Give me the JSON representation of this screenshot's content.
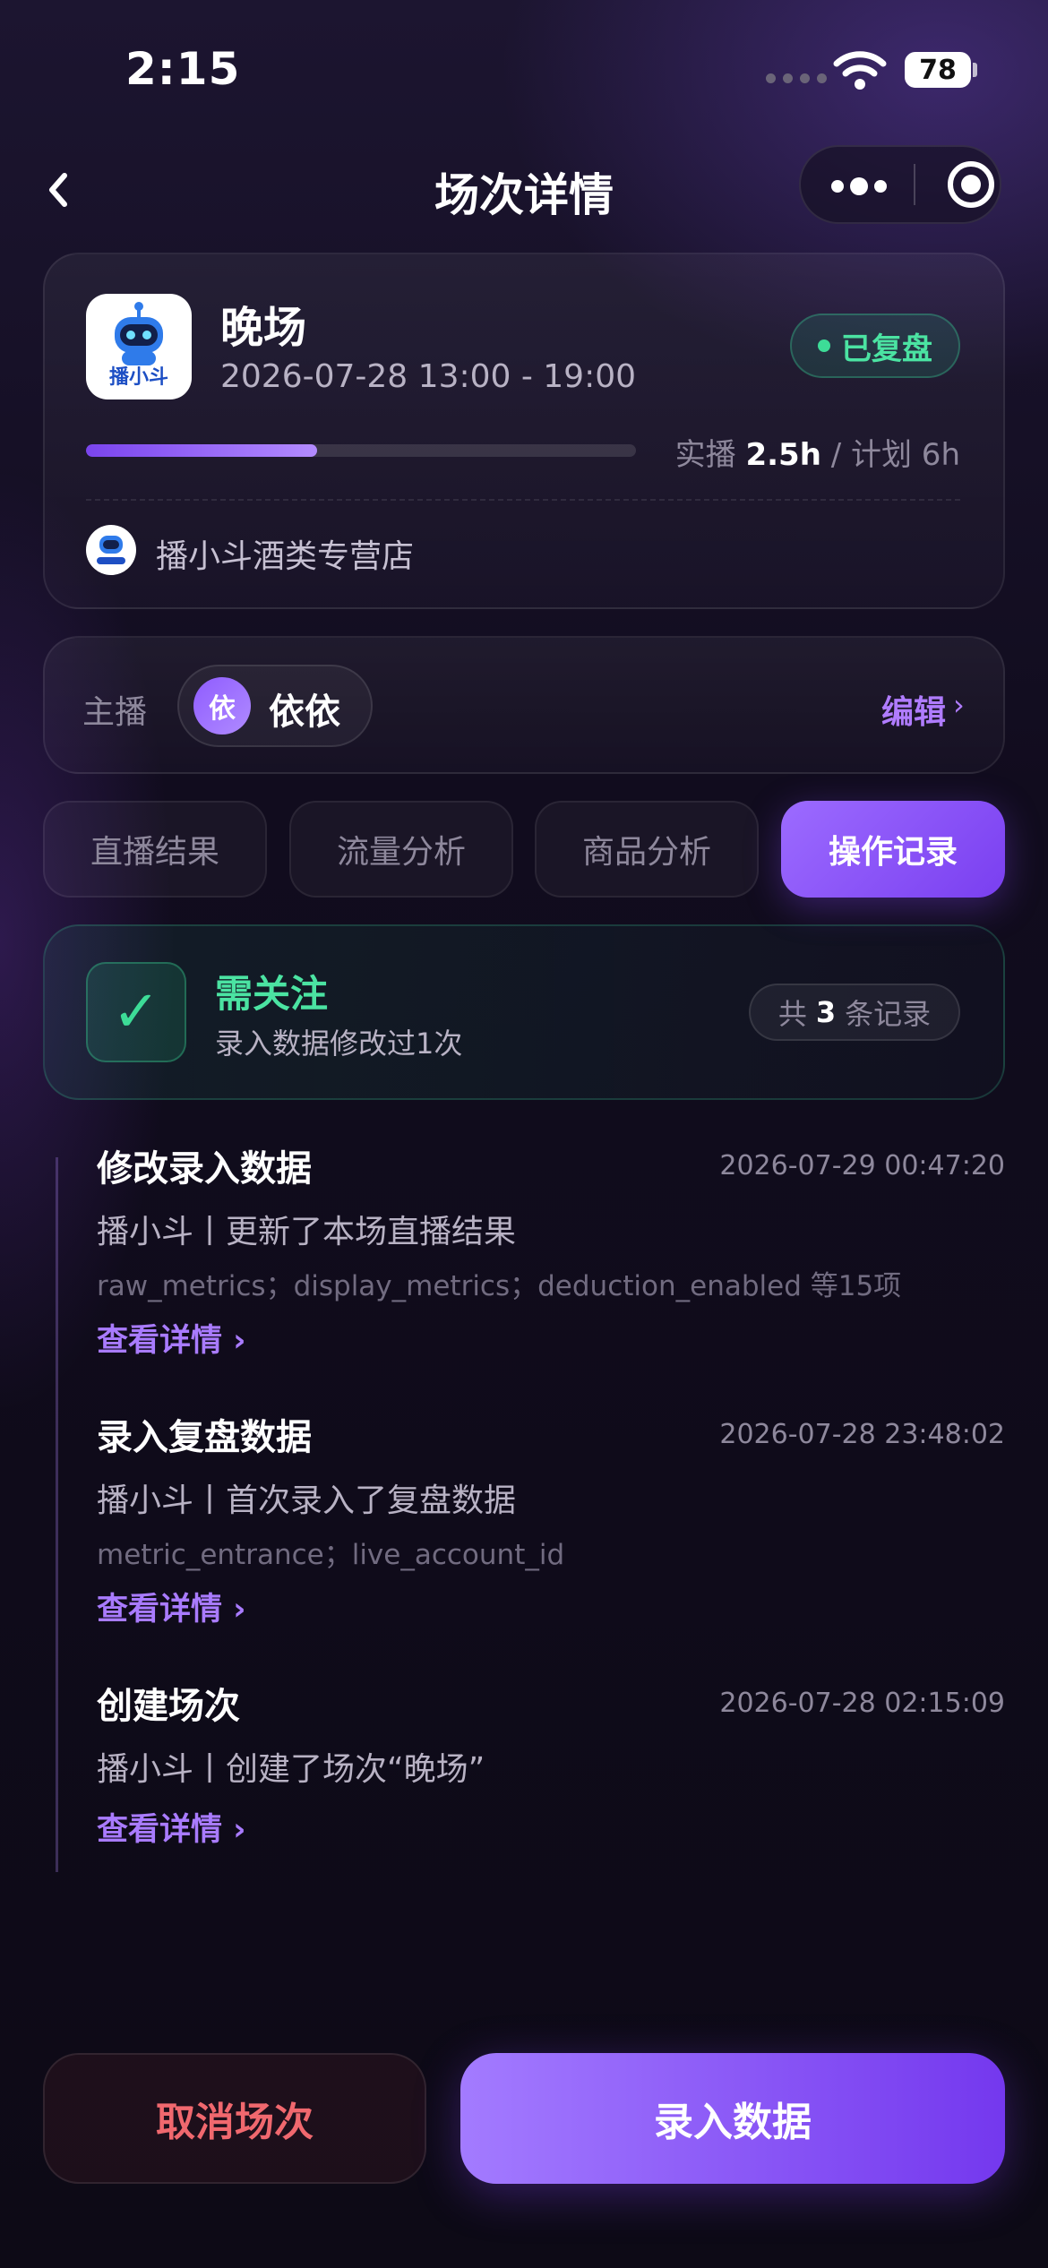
{
  "status_bar": {
    "time": "2:15",
    "battery": "78"
  },
  "nav": {
    "title": "场次详情"
  },
  "session": {
    "name": "晚场",
    "time_range": "2026-07-28 13:00 - 19:00",
    "status": "已复盘",
    "actual_label": "实播",
    "actual_value": "2.5h",
    "divider": "/",
    "plan_text": "计划 6h",
    "progress_fraction": 0.42,
    "shop_name": "播小斗酒类专营店",
    "logo_text": "播小斗"
  },
  "host": {
    "label": "主播",
    "avatar_text": "依",
    "name": "依依",
    "edit_label": "编辑",
    "chevron": "›"
  },
  "tabs": [
    {
      "label": "直播结果"
    },
    {
      "label": "流量分析"
    },
    {
      "label": "商品分析"
    },
    {
      "label": "操作记录"
    }
  ],
  "notice": {
    "check": "✓",
    "title": "需关注",
    "subtitle": "录入数据修改过1次",
    "count_prefix": "共",
    "count": "3",
    "count_suffix": "条记录"
  },
  "records": [
    {
      "title": "修改录入数据",
      "time": "2026-07-29 00:47:20",
      "desc": "播小斗丨更新了本场直播结果",
      "fields": "raw_metrics；display_metrics；deduction_enabled 等15项",
      "link": "查看详情 ›"
    },
    {
      "title": "录入复盘数据",
      "time": "2026-07-28 23:48:02",
      "desc": "播小斗丨首次录入了复盘数据",
      "fields": "metric_entrance；live_account_id",
      "link": "查看详情 ›"
    },
    {
      "title": "创建场次",
      "time": "2026-07-28 02:15:09",
      "desc": "播小斗丨创建了场次“晚场”",
      "link": "查看详情 ›"
    }
  ],
  "actions": {
    "cancel_label": "取消场次",
    "submit_label": "录入数据"
  },
  "colors": {
    "accent": "#9c6bff",
    "success": "#3ddc97",
    "danger": "#f0686e"
  }
}
